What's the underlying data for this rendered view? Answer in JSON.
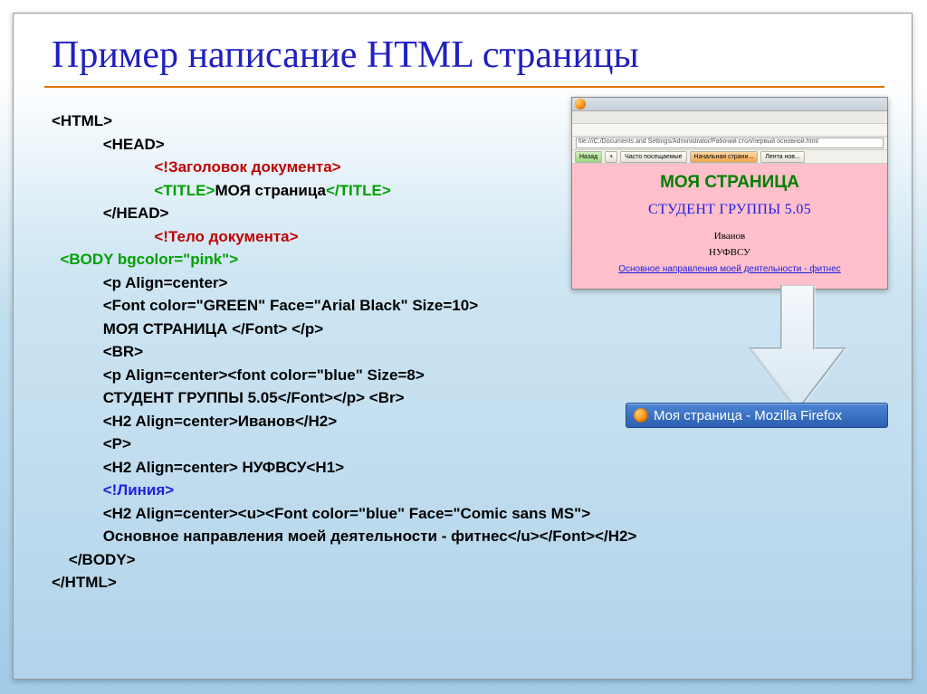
{
  "slide_title": "Пример написание HTML страницы",
  "code": {
    "l1": "<HTML>",
    "l2": "<HEAD>",
    "l3": "<!Заголовок документа>",
    "l4a": "<TITLE>",
    "l4b": "МОЯ страница",
    "l4c": "</TITLE>",
    "l5": "</HEAD>",
    "l6": "<!Тело документа>",
    "l7": "<BODY bgcolor=\"pink\">",
    "l8": "<p Align=center>",
    "l9": "<Font color=\"GREEN\" Face=\"Arial Black\" Size=10>",
    "l10a": "МОЯ СТРАНИЦА ",
    "l10b": "</Font> </p>",
    "l11": "<BR>",
    "l12": "<p Align=center><font color=\"blue\" Size=8>",
    "l13a": "СТУДЕНТ ГРУППЫ 5.05",
    "l13b": "</Font></p> <Br>",
    "l14": "<H2 Align=center>Иванов</H2>",
    "l15": "<P>",
    "l16": "<H2 Align=center> НУФВСУ<H1>",
    "l17": "<!Линия>",
    "l18": "<H2 Align=center><u><Font color=\"blue\" Face=\"Comic sans MS\">",
    "l19a": "Основное направления моей деятельности - фитнес",
    "l19b": "</u></Font></H2>",
    "l20": "</BODY>",
    "l21": "</HTML>"
  },
  "preview": {
    "addr": "file:///C:/Documents and Settings/Administrator/Рабочий стол/первый основной.html",
    "tool_back": "Назад",
    "tool_plus": "+",
    "tool_bookmarks": "Часто посещаемые",
    "tool_start": "Начальная страни...",
    "tool_news": "Лента нов...",
    "page_h1": "МОЯ СТРАНИЦА",
    "page_sub": "СТУДЕНТ ГРУППЫ 5.05",
    "page_name": "Иванов",
    "page_uni": "НУФВСУ",
    "page_link": "Основное направления моей деятельности -  фитнес"
  },
  "taskbar_label": "Моя страница - Mozilla Firefox"
}
